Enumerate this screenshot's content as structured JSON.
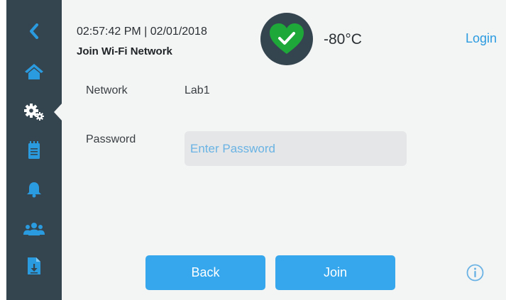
{
  "sidebar": {
    "items": [
      {
        "name": "back-chevron-icon"
      },
      {
        "name": "home-icon"
      },
      {
        "name": "settings-gears-icon",
        "active": true
      },
      {
        "name": "notepad-icon"
      },
      {
        "name": "bell-icon"
      },
      {
        "name": "users-group-icon"
      },
      {
        "name": "file-download-icon"
      }
    ]
  },
  "header": {
    "datetime": "02:57:42 PM | 02/01/2018",
    "subtitle": "Join Wi-Fi Network",
    "status_icon": "heart-check-icon",
    "temperature": "-80°C",
    "login_label": "Login"
  },
  "form": {
    "network_label": "Network",
    "network_value": "Lab1",
    "password_label": "Password",
    "password_value": "",
    "password_placeholder": "Enter Password"
  },
  "actions": {
    "back_label": "Back",
    "join_label": "Join",
    "info_icon": "info-icon"
  },
  "colors": {
    "sidebar": "#354550",
    "background": "#f3f4f4",
    "accent": "#36a7ec",
    "link": "#2b9be0",
    "status_green": "#1ea83a"
  }
}
